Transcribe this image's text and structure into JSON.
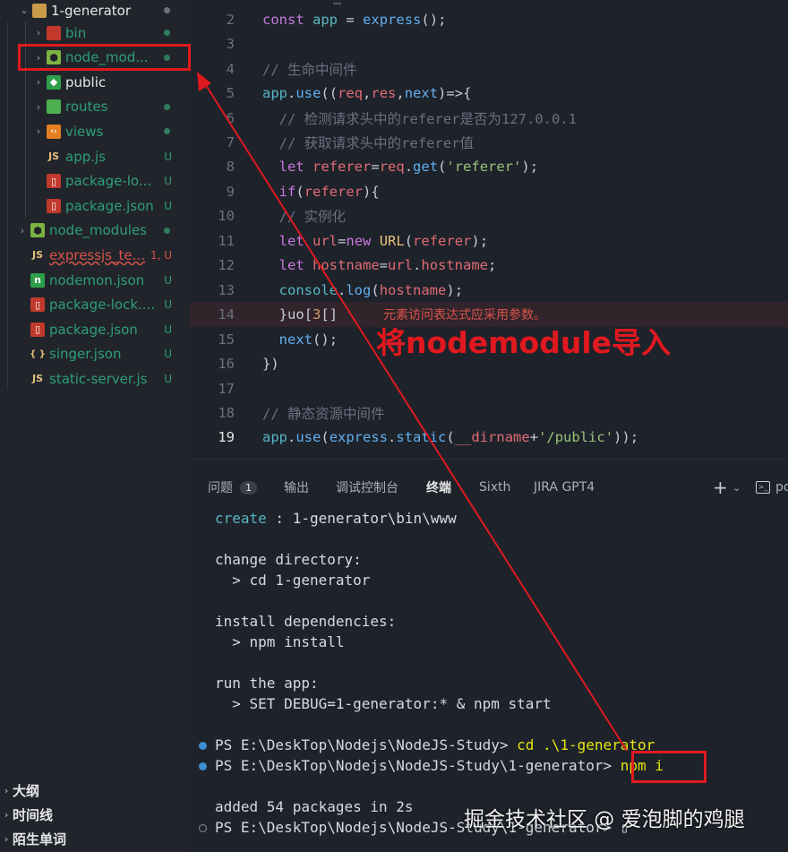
{
  "explorer": {
    "root": {
      "label": "1-generator"
    },
    "items": [
      {
        "label": "bin",
        "icon": "folder-bin-icon",
        "color": "#2e9e76",
        "status": "dot"
      },
      {
        "label": "node_mod...",
        "icon": "folder-node-icon",
        "color": "#2e9e76",
        "status": "dot"
      },
      {
        "label": "public",
        "icon": "folder-public-icon",
        "color": "#e6e6e6",
        "status": ""
      },
      {
        "label": "routes",
        "icon": "folder-routes-icon",
        "color": "#2e9e76",
        "status": "dot"
      },
      {
        "label": "views",
        "icon": "folder-views-icon",
        "color": "#2e9e76",
        "status": "dot"
      },
      {
        "label": "app.js",
        "icon": "js-file-icon",
        "color": "#2e9e76",
        "status": "U"
      },
      {
        "label": "package-lo...",
        "icon": "json-file-icon",
        "color": "#2e9e76",
        "status": "U"
      },
      {
        "label": "package.json",
        "icon": "json-file-icon",
        "color": "#2e9e76",
        "status": "U"
      },
      {
        "label": "node_modules",
        "icon": "folder-node-icon",
        "color": "#2e9e76",
        "status": "dot"
      },
      {
        "label": "expressjs_te...",
        "icon": "js-file-icon",
        "color": "#d8534a",
        "status": "1, U"
      },
      {
        "label": "nodemon.json",
        "icon": "nodemon-file-icon",
        "color": "#2e9e76",
        "status": "U"
      },
      {
        "label": "package-lock....",
        "icon": "json-file-icon",
        "color": "#2e9e76",
        "status": "U"
      },
      {
        "label": "package.json",
        "icon": "json-file-icon",
        "color": "#2e9e76",
        "status": "U"
      },
      {
        "label": "singer.json",
        "icon": "braces-file-icon",
        "color": "#2e9e76",
        "status": "U"
      },
      {
        "label": "static-server.js",
        "icon": "js-file-icon",
        "color": "#2e9e76",
        "status": "U"
      }
    ],
    "outline": [
      "大纲",
      "时间线",
      "陌生单词"
    ]
  },
  "editor": {
    "lines": [
      {
        "n": "2",
        "text": "const app = express();"
      },
      {
        "n": "3",
        "text": ""
      },
      {
        "n": "4",
        "text": "// 生命中间件"
      },
      {
        "n": "5",
        "text": "app.use((req,res,next)=>{"
      },
      {
        "n": "6",
        "text": "  // 检测请求头中的referer是否为127.0.0.1"
      },
      {
        "n": "7",
        "text": "  // 获取请求头中的referer值"
      },
      {
        "n": "8",
        "text": "  let referer=req.get('referer');"
      },
      {
        "n": "9",
        "text": "  if(referer){"
      },
      {
        "n": "10",
        "text": "  // 实例化"
      },
      {
        "n": "11",
        "text": "  let url=new URL(referer);"
      },
      {
        "n": "12",
        "text": "  let hostname=url.hostname;"
      },
      {
        "n": "13",
        "text": "  console.log(hostname);"
      },
      {
        "n": "14",
        "text": "  }uo[3[]"
      },
      {
        "n": "15",
        "text": "  next();"
      },
      {
        "n": "16",
        "text": "})"
      },
      {
        "n": "17",
        "text": ""
      },
      {
        "n": "18",
        "text": "// 静态资源中间件"
      },
      {
        "n": "19",
        "text": "app.use(express.static(__dirname+'/public'));"
      }
    ],
    "error_message": "元素访问表达式应采用参数。"
  },
  "panel": {
    "tabs": [
      {
        "label": "问题",
        "count": "1"
      },
      {
        "label": "输出"
      },
      {
        "label": "调试控制台"
      },
      {
        "label": "终端"
      },
      {
        "label": "Sixth"
      },
      {
        "label": "JIRA GPT4"
      }
    ],
    "add_icon": "plus-icon",
    "shell_label": "po",
    "terminal_lines": [
      {
        "text": "create : 1-generator\\bin\\www"
      },
      {
        "text": ""
      },
      {
        "text": "change directory:"
      },
      {
        "text": "  > cd 1-generator"
      },
      {
        "text": ""
      },
      {
        "text": "install dependencies:"
      },
      {
        "text": "  > npm install"
      },
      {
        "text": ""
      },
      {
        "text": "run the app:"
      },
      {
        "text": "  > SET DEBUG=1-generator:* & npm start"
      },
      {
        "text": ""
      },
      {
        "prompt": "PS E:\\DeskTop\\Nodejs\\NodeJS-Study> ",
        "cmd": "cd .\\1-generator"
      },
      {
        "prompt": "PS E:\\DeskTop\\Nodejs\\NodeJS-Study\\1-generator> ",
        "cmd": "npm i"
      },
      {
        "text": ""
      },
      {
        "text": "added 54 packages in 2s"
      },
      {
        "prompt": "PS E:\\DeskTop\\Nodejs\\NodeJS-Study\\1-generator> ",
        "cmd": ""
      }
    ]
  },
  "annotation": {
    "text": "将nodemodule导入"
  },
  "watermark": {
    "text": "掘金技术社区 @ 爱泡脚的鸡腿"
  },
  "colors": {
    "annotation_red": "#e0191f",
    "accent_blue": "#3b8ed0"
  }
}
